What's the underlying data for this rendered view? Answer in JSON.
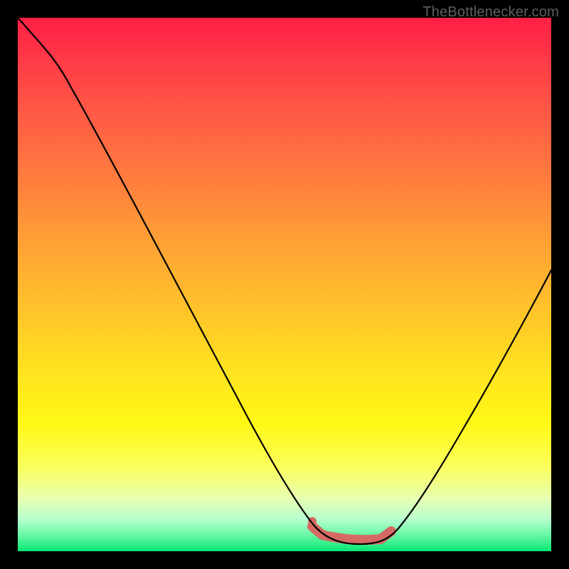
{
  "watermark": {
    "text": "TheBottlenecker.com"
  },
  "colors": {
    "page_bg": "#000000",
    "curve": "#000000",
    "highlight": "#d46a63",
    "gradient_top": "#ff1f44",
    "gradient_bottom": "#06e874"
  },
  "chart_data": {
    "type": "line",
    "title": "",
    "xlabel": "",
    "ylabel": "",
    "xlim": [
      0,
      100
    ],
    "ylim": [
      0,
      100
    ],
    "grid": false,
    "legend": false,
    "series": [
      {
        "name": "bottleneck-curve",
        "x": [
          0,
          5,
          10,
          15,
          20,
          25,
          30,
          35,
          40,
          45,
          50,
          53,
          55,
          58,
          60,
          63,
          66,
          68,
          70,
          73,
          76,
          80,
          85,
          90,
          95,
          100
        ],
        "values": [
          100,
          94,
          87,
          79,
          72,
          64,
          56,
          48,
          40,
          31,
          22,
          15,
          10,
          6,
          4,
          3,
          2,
          2,
          3,
          4,
          7,
          12,
          20,
          30,
          41,
          53
        ]
      }
    ],
    "highlight_range": {
      "x_start": 55,
      "x_end": 70,
      "y_approx": 3
    },
    "cursor": {
      "x": 55,
      "y": 5
    },
    "background_gradient": {
      "orientation": "vertical",
      "stops": [
        {
          "pos": 0.0,
          "color": "#ff1f44"
        },
        {
          "pos": 0.3,
          "color": "#ff7c3e"
        },
        {
          "pos": 0.55,
          "color": "#ffc42a"
        },
        {
          "pos": 0.76,
          "color": "#fff815"
        },
        {
          "pos": 0.9,
          "color": "#e8ffb0"
        },
        {
          "pos": 1.0,
          "color": "#06e874"
        }
      ]
    }
  }
}
